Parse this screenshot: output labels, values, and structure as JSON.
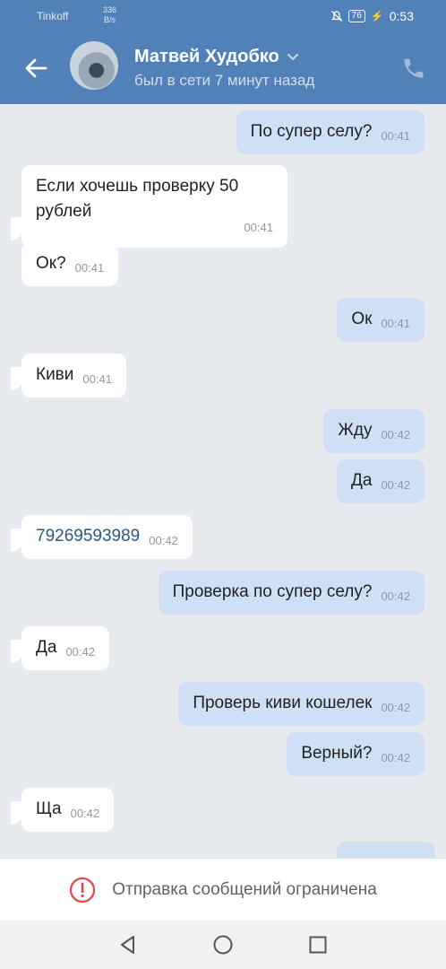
{
  "status_bar": {
    "carrier": "Tinkoff",
    "net_speed_value": "336",
    "net_speed_unit": "B/s",
    "battery": "76",
    "time": "0:53"
  },
  "header": {
    "contact_name": "Матвей Худобко",
    "last_seen": "был в сети 7 минут назад"
  },
  "messages": [
    {
      "dir": "out",
      "text": "По супер селу?",
      "time": "00:41"
    },
    {
      "dir": "in",
      "text": "Если хочешь проверку 50 рублей",
      "time": "00:41"
    },
    {
      "dir": "in",
      "text": "Ок?",
      "time": "00:41"
    },
    {
      "dir": "out",
      "text": "Ок",
      "time": "00:41"
    },
    {
      "dir": "in",
      "text": "Киви",
      "time": "00:41"
    },
    {
      "dir": "out",
      "text": "Жду",
      "time": "00:42"
    },
    {
      "dir": "out",
      "text": "Да",
      "time": "00:42"
    },
    {
      "dir": "in",
      "text": "79269593989",
      "time": "00:42"
    },
    {
      "dir": "out",
      "text": "Проверка по супер селу?",
      "time": "00:42"
    },
    {
      "dir": "in",
      "text": "Да",
      "time": "00:42"
    },
    {
      "dir": "out",
      "text": "Проверь киви кошелек",
      "time": "00:42"
    },
    {
      "dir": "out",
      "text": "Верный?",
      "time": "00:42"
    },
    {
      "dir": "in",
      "text": "Ща",
      "time": "00:42"
    }
  ],
  "footer": {
    "restriction_text": "Отправка сообщений ограничена",
    "icon": "warning-circle-icon",
    "accent": "#e64646"
  },
  "colors": {
    "header_bg": "#5181b8",
    "chat_bg": "#e7ebf0",
    "outgoing_bubble": "#cfe0f5",
    "incoming_bubble": "#ffffff",
    "link": "#2a5885"
  }
}
